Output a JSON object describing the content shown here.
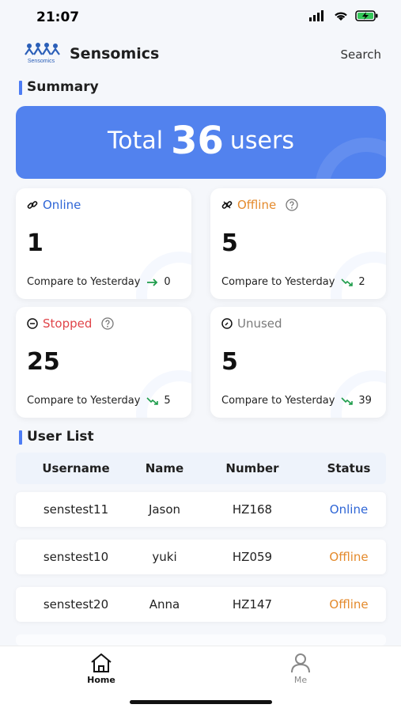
{
  "status_bar": {
    "time": "21:07"
  },
  "header": {
    "app_name": "Sensomics",
    "logo_text": "Sensomics",
    "search_label": "Search"
  },
  "summary": {
    "title": "Summary",
    "total_prefix": "Total",
    "total_count": "36",
    "total_suffix": "users",
    "compare_label": "Compare to Yesterday",
    "cards": [
      {
        "label": "Online",
        "value": "1",
        "delta": "0",
        "color": "#2f66d6",
        "trend": "flat",
        "icon": "link-icon",
        "has_help": false
      },
      {
        "label": "Offline",
        "value": "5",
        "delta": "2",
        "color": "#e48a2c",
        "trend": "down",
        "icon": "broken-link-icon",
        "has_help": true
      },
      {
        "label": "Stopped",
        "value": "25",
        "delta": "5",
        "color": "#e0454a",
        "trend": "down",
        "icon": "stop-circle-icon",
        "has_help": true
      },
      {
        "label": "Unused",
        "value": "5",
        "delta": "39",
        "color": "#7a7a7a",
        "trend": "down",
        "icon": "clock-icon",
        "has_help": false
      }
    ]
  },
  "user_list": {
    "title": "User List",
    "columns": [
      "Username",
      "Name",
      "Number",
      "Status"
    ],
    "rows": [
      {
        "username": "senstest11",
        "name": "Jason",
        "number": "HZ168",
        "status": "Online",
        "status_color": "#2f66d6"
      },
      {
        "username": "senstest10",
        "name": "yuki",
        "number": "HZ059",
        "status": "Offline",
        "status_color": "#e48a2c"
      },
      {
        "username": "senstest20",
        "name": "Anna",
        "number": "HZ147",
        "status": "Offline",
        "status_color": "#e48a2c"
      }
    ]
  },
  "tabs": [
    {
      "label": "Home",
      "active": true
    },
    {
      "label": "Me",
      "active": false
    }
  ],
  "colors": {
    "accent": "#5282ee",
    "trend_green": "#1f9d4c"
  }
}
